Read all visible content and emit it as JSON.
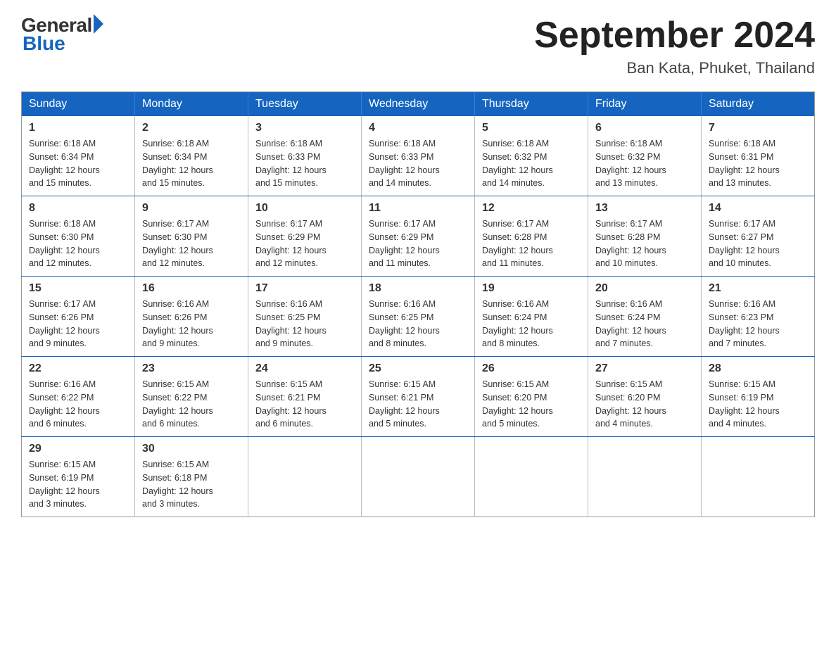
{
  "logo": {
    "general": "General",
    "blue": "Blue"
  },
  "title": "September 2024",
  "subtitle": "Ban Kata, Phuket, Thailand",
  "days": [
    "Sunday",
    "Monday",
    "Tuesday",
    "Wednesday",
    "Thursday",
    "Friday",
    "Saturday"
  ],
  "weeks": [
    [
      {
        "day": "1",
        "sunrise": "6:18 AM",
        "sunset": "6:34 PM",
        "daylight": "12 hours and 15 minutes."
      },
      {
        "day": "2",
        "sunrise": "6:18 AM",
        "sunset": "6:34 PM",
        "daylight": "12 hours and 15 minutes."
      },
      {
        "day": "3",
        "sunrise": "6:18 AM",
        "sunset": "6:33 PM",
        "daylight": "12 hours and 15 minutes."
      },
      {
        "day": "4",
        "sunrise": "6:18 AM",
        "sunset": "6:33 PM",
        "daylight": "12 hours and 14 minutes."
      },
      {
        "day": "5",
        "sunrise": "6:18 AM",
        "sunset": "6:32 PM",
        "daylight": "12 hours and 14 minutes."
      },
      {
        "day": "6",
        "sunrise": "6:18 AM",
        "sunset": "6:32 PM",
        "daylight": "12 hours and 13 minutes."
      },
      {
        "day": "7",
        "sunrise": "6:18 AM",
        "sunset": "6:31 PM",
        "daylight": "12 hours and 13 minutes."
      }
    ],
    [
      {
        "day": "8",
        "sunrise": "6:18 AM",
        "sunset": "6:30 PM",
        "daylight": "12 hours and 12 minutes."
      },
      {
        "day": "9",
        "sunrise": "6:17 AM",
        "sunset": "6:30 PM",
        "daylight": "12 hours and 12 minutes."
      },
      {
        "day": "10",
        "sunrise": "6:17 AM",
        "sunset": "6:29 PM",
        "daylight": "12 hours and 12 minutes."
      },
      {
        "day": "11",
        "sunrise": "6:17 AM",
        "sunset": "6:29 PM",
        "daylight": "12 hours and 11 minutes."
      },
      {
        "day": "12",
        "sunrise": "6:17 AM",
        "sunset": "6:28 PM",
        "daylight": "12 hours and 11 minutes."
      },
      {
        "day": "13",
        "sunrise": "6:17 AM",
        "sunset": "6:28 PM",
        "daylight": "12 hours and 10 minutes."
      },
      {
        "day": "14",
        "sunrise": "6:17 AM",
        "sunset": "6:27 PM",
        "daylight": "12 hours and 10 minutes."
      }
    ],
    [
      {
        "day": "15",
        "sunrise": "6:17 AM",
        "sunset": "6:26 PM",
        "daylight": "12 hours and 9 minutes."
      },
      {
        "day": "16",
        "sunrise": "6:16 AM",
        "sunset": "6:26 PM",
        "daylight": "12 hours and 9 minutes."
      },
      {
        "day": "17",
        "sunrise": "6:16 AM",
        "sunset": "6:25 PM",
        "daylight": "12 hours and 9 minutes."
      },
      {
        "day": "18",
        "sunrise": "6:16 AM",
        "sunset": "6:25 PM",
        "daylight": "12 hours and 8 minutes."
      },
      {
        "day": "19",
        "sunrise": "6:16 AM",
        "sunset": "6:24 PM",
        "daylight": "12 hours and 8 minutes."
      },
      {
        "day": "20",
        "sunrise": "6:16 AM",
        "sunset": "6:24 PM",
        "daylight": "12 hours and 7 minutes."
      },
      {
        "day": "21",
        "sunrise": "6:16 AM",
        "sunset": "6:23 PM",
        "daylight": "12 hours and 7 minutes."
      }
    ],
    [
      {
        "day": "22",
        "sunrise": "6:16 AM",
        "sunset": "6:22 PM",
        "daylight": "12 hours and 6 minutes."
      },
      {
        "day": "23",
        "sunrise": "6:15 AM",
        "sunset": "6:22 PM",
        "daylight": "12 hours and 6 minutes."
      },
      {
        "day": "24",
        "sunrise": "6:15 AM",
        "sunset": "6:21 PM",
        "daylight": "12 hours and 6 minutes."
      },
      {
        "day": "25",
        "sunrise": "6:15 AM",
        "sunset": "6:21 PM",
        "daylight": "12 hours and 5 minutes."
      },
      {
        "day": "26",
        "sunrise": "6:15 AM",
        "sunset": "6:20 PM",
        "daylight": "12 hours and 5 minutes."
      },
      {
        "day": "27",
        "sunrise": "6:15 AM",
        "sunset": "6:20 PM",
        "daylight": "12 hours and 4 minutes."
      },
      {
        "day": "28",
        "sunrise": "6:15 AM",
        "sunset": "6:19 PM",
        "daylight": "12 hours and 4 minutes."
      }
    ],
    [
      {
        "day": "29",
        "sunrise": "6:15 AM",
        "sunset": "6:19 PM",
        "daylight": "12 hours and 3 minutes."
      },
      {
        "day": "30",
        "sunrise": "6:15 AM",
        "sunset": "6:18 PM",
        "daylight": "12 hours and 3 minutes."
      },
      null,
      null,
      null,
      null,
      null
    ]
  ],
  "labels": {
    "sunrise": "Sunrise:",
    "sunset": "Sunset:",
    "daylight": "Daylight:"
  }
}
